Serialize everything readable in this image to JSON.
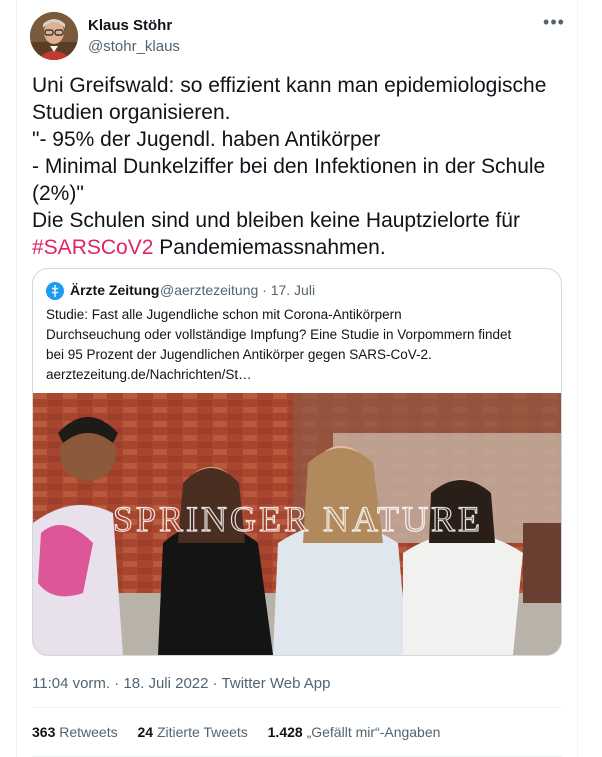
{
  "author": {
    "name": "Klaus Stöhr",
    "handle": "@stohr_klaus"
  },
  "more_icon": "more-horizontal-icon",
  "tweet": {
    "text_before": "Uni Greifswald: so effizient kann man epidemiologische Studien organisieren.\n\"- 95% der Jugendl. haben Antikörper\n- Minimal Dunkelziffer bei den Infektionen in der Schule (2%)\"\nDie Schulen sind und bleiben keine Hauptzielorte für\n",
    "hashtag": "#SARSCoV2",
    "text_after": "  Pandemiemassnahmen."
  },
  "quoted": {
    "name": "Ärzte Zeitung",
    "handle_date": "@aerztezeitung · 17. Juli",
    "text": "Studie: Fast alle Jugendliche schon mit Corona-Antikörpern\nDurchseuchung oder vollständige Impfung? Eine Studie in Vorpommern findet\nbei 95 Prozent der Jugendlichen Antikörper gegen SARS-CoV-2.\naerztezeitung.de/Nachrichten/St…",
    "image_watermark": "SPRINGER NATURE",
    "accent_color": "#1d9bf0"
  },
  "meta": {
    "timestamp": "11:04 vorm. · 18. Juli 2022 · Twitter Web App"
  },
  "stats": {
    "retweets_count": "363",
    "retweets_label": "Retweets",
    "quotes_count": "24",
    "quotes_label": "Zitierte Tweets",
    "likes_count": "1.428",
    "likes_label": "„Gefällt mir“-Angaben"
  },
  "colors": {
    "text": "#0f1419",
    "secondary": "#536471",
    "hashtag": "#e0245e",
    "border": "#cfd9de"
  }
}
